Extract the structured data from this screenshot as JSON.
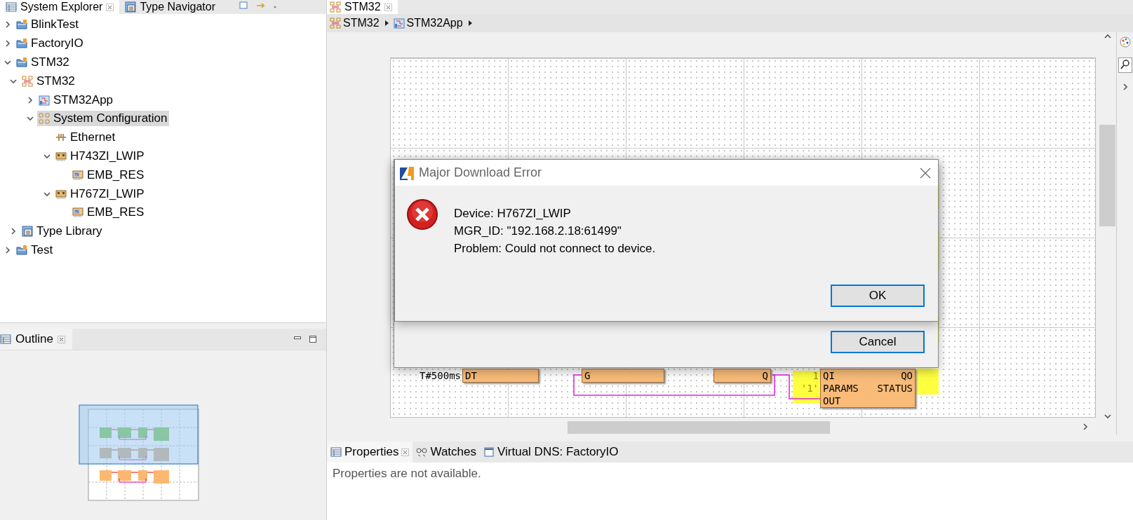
{
  "explorer": {
    "tabs": [
      {
        "label": "System Explorer",
        "selected": true
      },
      {
        "label": "Type Navigator",
        "selected": false
      }
    ],
    "tree": [
      {
        "label": "BlinkTest",
        "kind": "project",
        "expanded": false,
        "selected": false
      },
      {
        "label": "FactoryIO",
        "kind": "project",
        "expanded": false,
        "selected": false
      },
      {
        "label": "STM32",
        "kind": "project",
        "expanded": true,
        "selected": false,
        "children": [
          {
            "label": "STM32",
            "kind": "system",
            "expanded": true,
            "selected": false,
            "children": [
              {
                "label": "STM32App",
                "kind": "application",
                "expanded": false,
                "selected": false
              },
              {
                "label": "System Configuration",
                "kind": "sysconf",
                "expanded": true,
                "selected": true,
                "children": [
                  {
                    "label": "Ethernet",
                    "kind": "segment",
                    "selected": false
                  },
                  {
                    "label": "H743ZI_LWIP",
                    "kind": "device",
                    "expanded": true,
                    "selected": false,
                    "children": [
                      {
                        "label": "EMB_RES",
                        "kind": "resource",
                        "selected": false
                      }
                    ]
                  },
                  {
                    "label": "H767ZI_LWIP",
                    "kind": "device",
                    "expanded": true,
                    "selected": false,
                    "children": [
                      {
                        "label": "EMB_RES",
                        "kind": "resource",
                        "selected": false
                      }
                    ]
                  }
                ]
              }
            ]
          },
          {
            "label": "Type Library",
            "kind": "library",
            "expanded": false,
            "selected": false
          }
        ]
      },
      {
        "label": "Test",
        "kind": "project",
        "expanded": false,
        "selected": false
      }
    ]
  },
  "outline": {
    "tab": {
      "label": "Outline"
    }
  },
  "editor": {
    "tab": {
      "label": "STM32"
    },
    "breadcrumb": [
      {
        "label": "STM32",
        "kind": "system"
      },
      {
        "label": "STM32App",
        "kind": "application"
      }
    ],
    "blocks": [
      {
        "highlighted": false,
        "rows": [
          {
            "value": "T#500ms",
            "input": "DT"
          }
        ]
      },
      {
        "highlighted": false,
        "rows": [
          {
            "input": "G"
          }
        ]
      },
      {
        "highlighted": false,
        "rows": [
          {
            "output": "Q"
          }
        ]
      },
      {
        "highlighted": true,
        "rows": [
          {
            "value": "1",
            "input": "QI",
            "output": "QO"
          },
          {
            "value": "'1'",
            "input": "PARAMS",
            "output": "STATUS"
          },
          {
            "input": "OUT"
          }
        ]
      }
    ]
  },
  "properties_view": {
    "tabs": [
      {
        "label": "Properties",
        "kind": "properties",
        "selected": true
      },
      {
        "label": "Watches",
        "kind": "watches",
        "selected": false
      },
      {
        "label": "Virtual DNS: FactoryIO",
        "kind": "dns",
        "selected": false
      }
    ],
    "message": "Properties are not available."
  },
  "dialogs": [
    {
      "title": "Major Download Error",
      "lines": [
        "Device: H767ZI_LWIP",
        "MGR_ID: \"192.168.2.18:61499\"",
        "Problem: Could not connect to device."
      ],
      "buttons": [
        {
          "label": "OK"
        }
      ]
    },
    {
      "buttons": [
        {
          "label": "Cancel"
        }
      ]
    }
  ]
}
